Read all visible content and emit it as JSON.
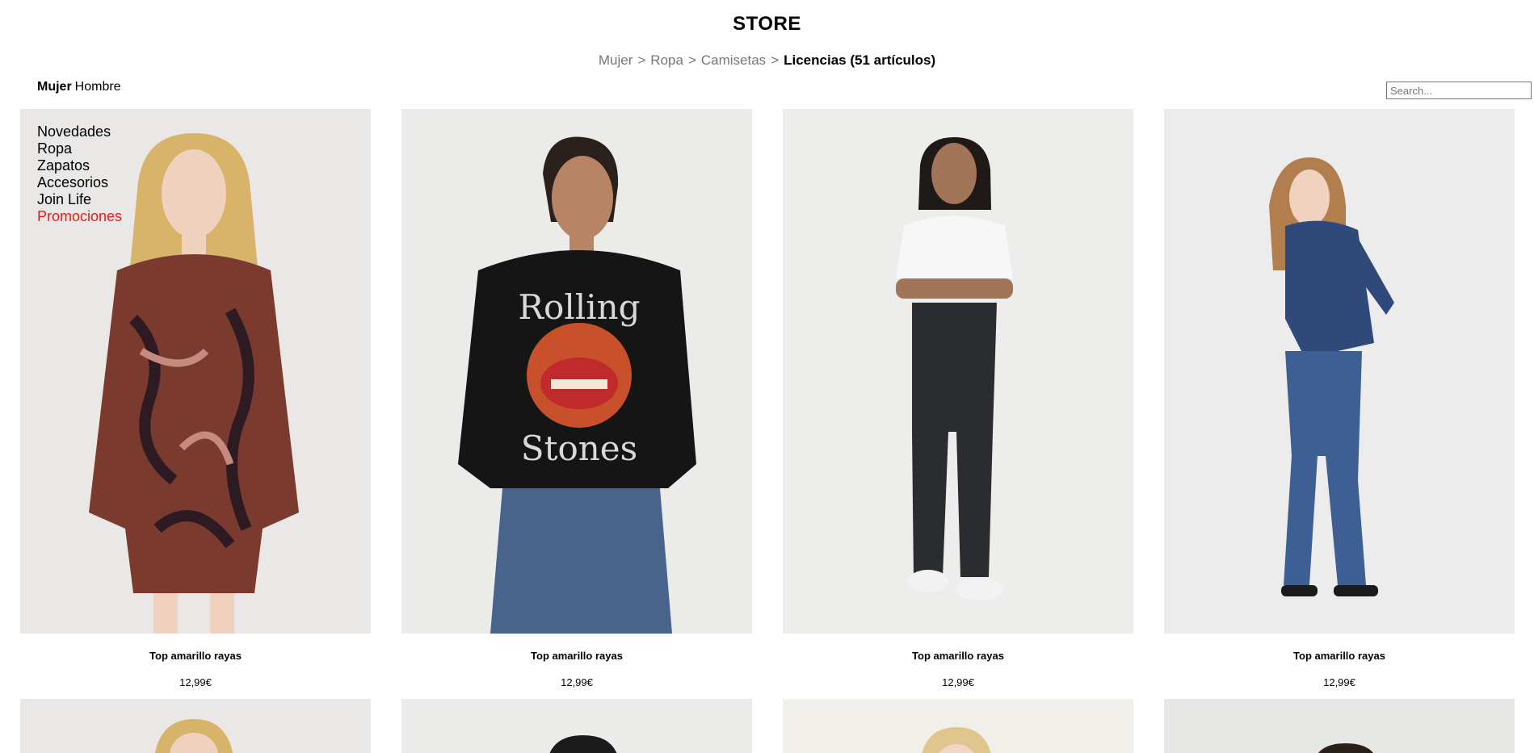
{
  "store": {
    "title": "STORE"
  },
  "breadcrumb": {
    "items": [
      "Mujer",
      "Ropa",
      "Camisetas"
    ],
    "separator": ">",
    "current": "Licencias (51 artículos)"
  },
  "gender_nav": {
    "active": "Mujer",
    "inactive": "Hombre"
  },
  "search": {
    "placeholder": "Search..."
  },
  "category_menu": {
    "items": [
      "Novedades",
      "Ropa",
      "Zapatos",
      "Accesorios",
      "Join Life"
    ],
    "promo": "Promociones",
    "promo_color": "#e8191c"
  },
  "products": [
    {
      "name": "Top amarillo rayas",
      "price": "12,99€",
      "image": "patterned-dress-photo"
    },
    {
      "name": "Top amarillo rayas",
      "price": "12,99€",
      "image": "band-sweatshirt-photo"
    },
    {
      "name": "Top amarillo rayas",
      "price": "12,99€",
      "image": "black-jeans-photo"
    },
    {
      "name": "Top amarillo rayas",
      "price": "12,99€",
      "image": "denim-outfit-photo"
    }
  ],
  "next_row_products": [
    {
      "image": "blonde-model-photo"
    },
    {
      "image": "dark-hair-model-photo"
    },
    {
      "image": "blonde-model-photo"
    },
    {
      "image": "curly-hair-model-photo"
    }
  ]
}
